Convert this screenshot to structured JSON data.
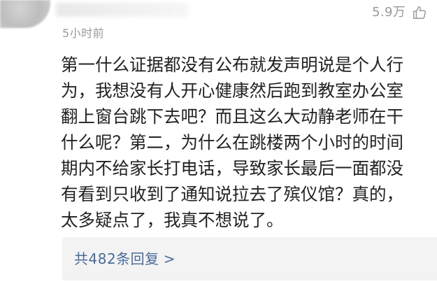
{
  "comment": {
    "timestamp": "5小时前",
    "likes": "5.9万",
    "lines": [
      "第一什么证据都没有公布就发声明说是个人行",
      "为，我想没有人开心健康然后跑到教室办公室",
      "翻上窗台跳下去吧？而且这么大动静老师在干",
      "什么呢？第二，为什么在跳楼两个小时的时间",
      "期内不给家长打电话，导致家长最后一面都没",
      "有看到只收到了通知说拉去了殡仪馆？真的，",
      "太多疑点了，我真不想说了。"
    ]
  },
  "replies": {
    "label": "共482条回复",
    "chevron": ">"
  },
  "icons": {
    "like": "thumbs-up-icon"
  },
  "colors": {
    "meta_gray": "#999999",
    "body_text": "#222222",
    "link_blue": "#496b9a",
    "reply_bg": "#f3f3f3"
  }
}
